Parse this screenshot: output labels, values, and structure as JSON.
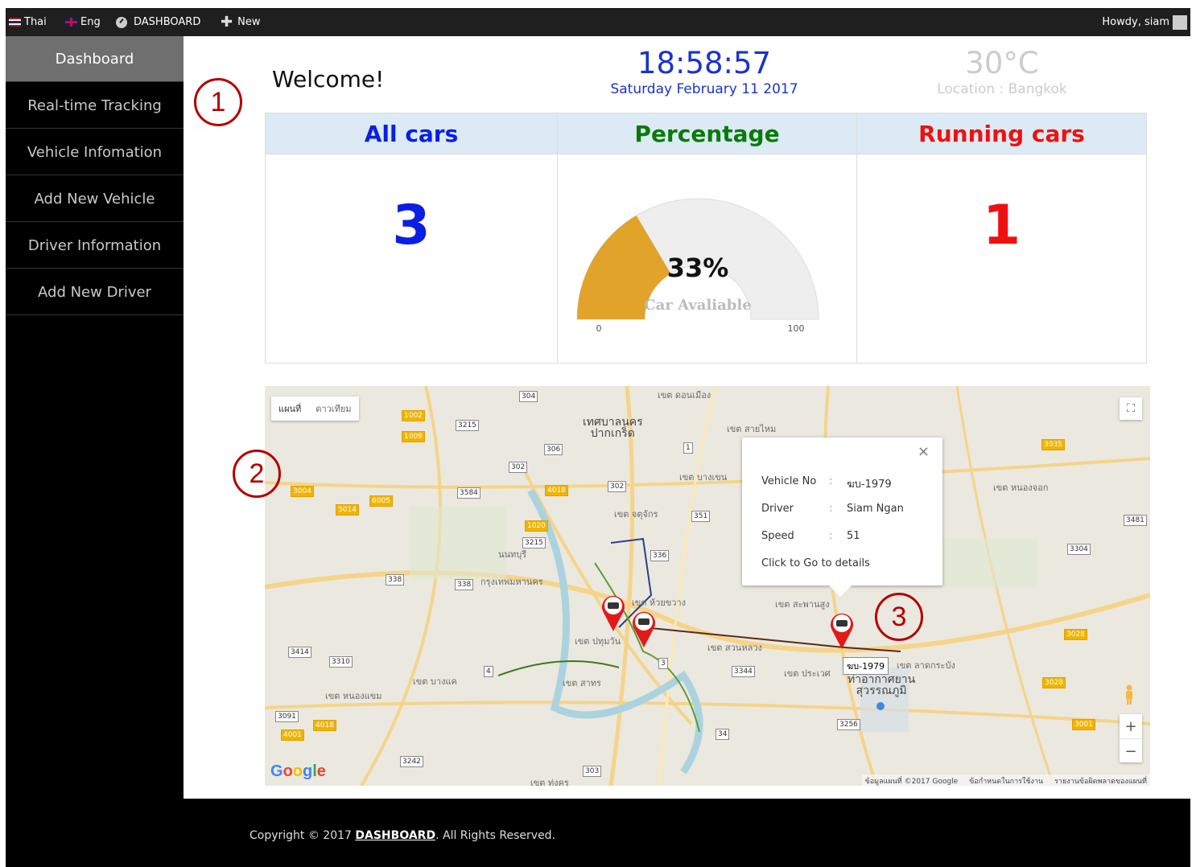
{
  "topbar": {
    "lang_thai": "Thai",
    "lang_eng": "Eng",
    "dashboard": "DASHBOARD",
    "new": "New",
    "greeting": "Howdy, siam"
  },
  "sidebar": {
    "items": [
      {
        "label": "Dashboard",
        "active": true
      },
      {
        "label": "Real-time Tracking"
      },
      {
        "label": "Vehicle Infomation"
      },
      {
        "label": "Add New Vehicle"
      },
      {
        "label": "Driver Information"
      },
      {
        "label": "Add New Driver"
      }
    ]
  },
  "header": {
    "welcome": "Welcome!",
    "time": "18:58:57",
    "date": "Saturday February 11 2017",
    "temperature": "30°C",
    "location": "Location : Bangkok"
  },
  "stats": {
    "all_cars": {
      "title": "All cars",
      "value": "3",
      "color": "#0a1ee6"
    },
    "percentage": {
      "title": "Percentage",
      "value": "33%",
      "caption": "Car Avaliable",
      "min": "0",
      "max": "100",
      "fraction": 0.33,
      "color": "#0a7a0a",
      "fill_color": "#e1a32a"
    },
    "running_cars": {
      "title": "Running cars",
      "value": "1",
      "color": "#ee1111"
    }
  },
  "map": {
    "type_map": "แผนที่",
    "type_satellite": "ดาวเทียม",
    "google": "Google",
    "attribution": [
      "ข้อมูลแผนที่ ©2017 Google",
      "ข้อกำหนดในการใช้งาน",
      "รายงานข้อผิดพลาดของแผนที่"
    ],
    "zoom_in": "+",
    "zoom_out": "−",
    "infowindow": {
      "vehicle_label": "Vehicle No",
      "vehicle_value": "ฆบ-1979",
      "driver_label": "Driver",
      "driver_value": "Siam Ngan",
      "speed_label": "Speed",
      "speed_value": "51",
      "separator": ":",
      "link": "Click to Go to details",
      "close": "×"
    },
    "tooltip": "ฆบ-1979",
    "places": {
      "pakkret": "เทศบาลนคร\nปากเกร็ด",
      "nonthaburi": "นนทบุรี",
      "bangkok": "กรุงเทพมหานคร",
      "don_mueang": "เขต ดอนเมือง",
      "sai_mai": "เขต สายไหม",
      "bang_khen": "เขต บางเขน",
      "chatuchak": "เขต จตุจักร",
      "huai_khwang": "เขต ห้วยขวาง",
      "saphan_sung": "เขต สะพานสูง",
      "suan_luang": "เขต สวนหลวง",
      "prawet": "เขต ประเวศ",
      "lat_krabang": "เขต ลาดกระบัง",
      "suvarnabhumi": "ท่าอากาศยาน\nสุวรรณภูมิ",
      "bang_khae": "เขต บางแค",
      "nong_khaem": "เขต หนองแขม",
      "sathon": "เขต สาทร",
      "pathum_wan": "เขต ปทุมวัน",
      "nong_chok": "เขต หนองจอก",
      "thung_khru": "เขต ทุ่งครุ"
    },
    "shields": [
      "304",
      "3215",
      "306",
      "302",
      "3584",
      "1",
      "302",
      "351",
      "336",
      "338",
      "338",
      "3414",
      "3310",
      "4",
      "3",
      "3344",
      "3091",
      "4018",
      "4001",
      "3242",
      "303",
      "34",
      "3256",
      "3481",
      "3304",
      "3028",
      "3028",
      "3001",
      "3035",
      "1002",
      "1009",
      "3004",
      "5014",
      "6005",
      "4018",
      "1020",
      "3215"
    ]
  },
  "annotations": [
    "1",
    "2",
    "3"
  ],
  "footer": {
    "prefix": "Copyright © 2017 ",
    "link": "DASHBOARD",
    "suffix": ". All Rights Reserved."
  }
}
